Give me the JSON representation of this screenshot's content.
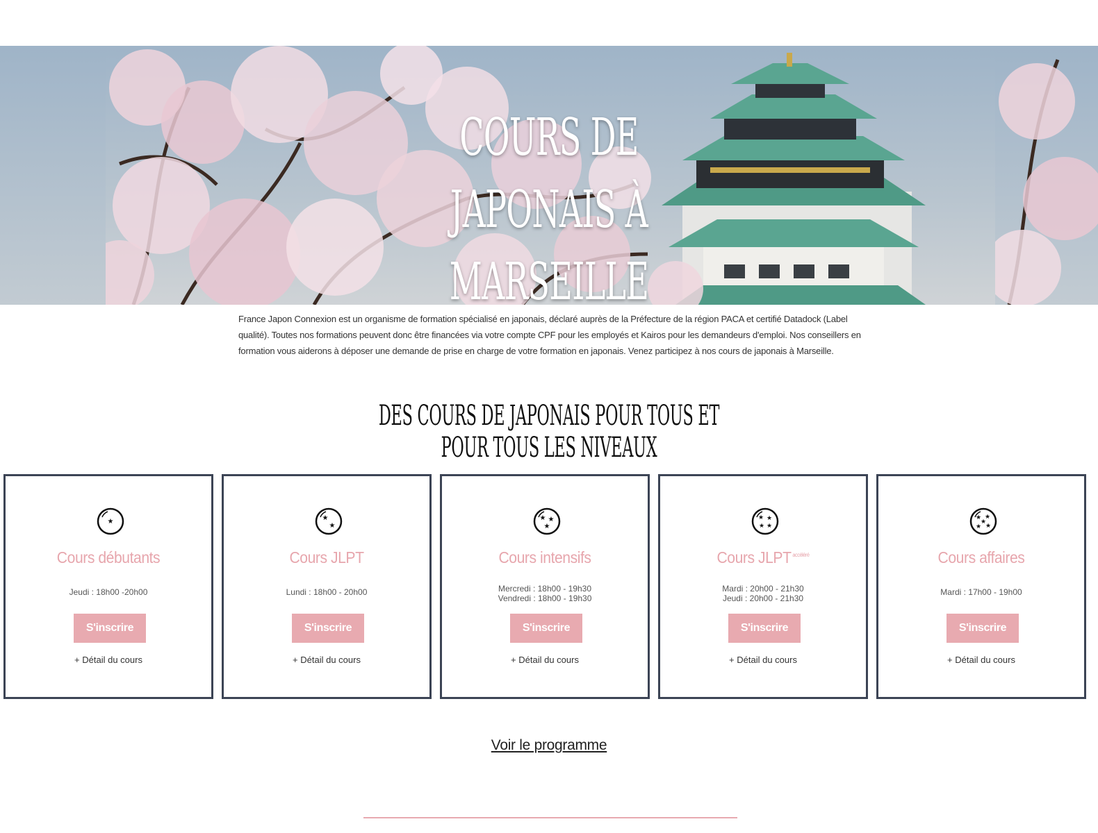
{
  "hero": {
    "title_line1": "Cours de japonais à",
    "title_line2": "Marseille"
  },
  "intro": {
    "text": "France Japon Connexion est un organisme de formation spécialisé en japonais, déclaré auprès de la Préfecture de la région PACA et certifié Datadock (Label qualité). Toutes nos formations peuvent donc être financées via votre compte CPF pour les employés et Kairos pour les demandeurs d'emploi. Nos conseillers en formation vous aiderons à déposer une demande de prise en charge de votre formation en japonais. Venez participez à nos cours de japonais à Marseille."
  },
  "section": {
    "title": "Des cours de japonais pour tous et pour tous les niveaux"
  },
  "cards": [
    {
      "title": "Cours débutants",
      "suffix": "",
      "stars": 1,
      "schedule": [
        "Jeudi : 18h00 -20h00"
      ],
      "button": "S'inscrire",
      "detail": "+ Détail du cours"
    },
    {
      "title": "Cours JLPT",
      "suffix": "",
      "stars": 2,
      "schedule": [
        "Lundi : 18h00 - 20h00"
      ],
      "button": "S'inscrire",
      "detail": "+ Détail du cours"
    },
    {
      "title": "Cours intensifs",
      "suffix": "",
      "stars": 3,
      "schedule": [
        "Mercredi : 18h00 - 19h30",
        "Vendredi : 18h00 - 19h30"
      ],
      "button": "S'inscrire",
      "detail": "+ Détail du cours"
    },
    {
      "title": "Cours JLPT",
      "suffix": "accéléré",
      "stars": 4,
      "schedule": [
        "Mardi : 20h00 - 21h30",
        "Jeudi : 20h00 - 21h30"
      ],
      "button": "S'inscrire",
      "detail": "+ Détail du cours"
    },
    {
      "title": "Cours affaires",
      "suffix": "",
      "stars": 5,
      "schedule": [
        "Mardi : 17h00 - 19h00"
      ],
      "button": "S'inscrire",
      "detail": "+ Détail du cours"
    }
  ],
  "program": {
    "link_label": "Voir le programme"
  },
  "colors": {
    "accent_pink": "#e8aab0",
    "title_pink": "#e7a6ad",
    "card_border": "#3c4455"
  },
  "icons": {
    "card_icon": "dragon-ball-star-icon"
  }
}
